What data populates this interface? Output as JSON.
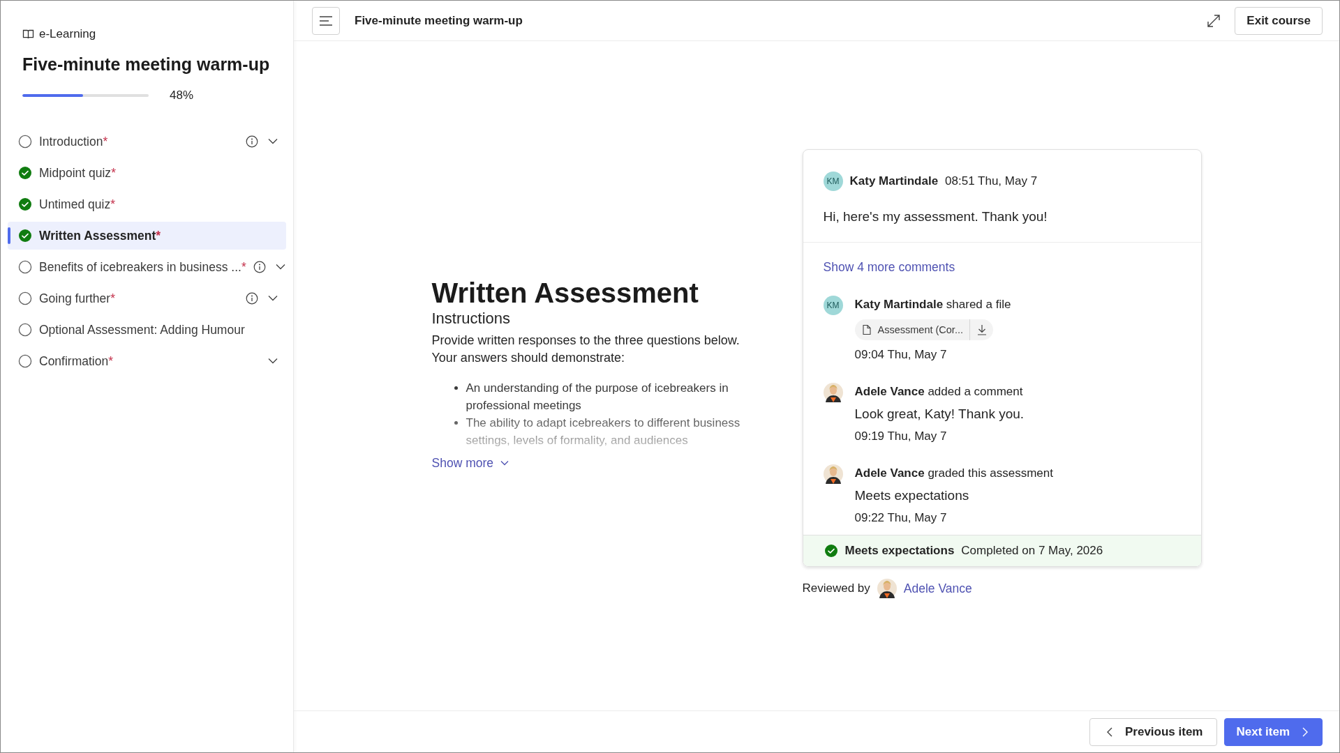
{
  "sidebar": {
    "app_name": "e-Learning",
    "course_title": "Five-minute meeting warm-up",
    "progress": {
      "level": 0.48,
      "reading": "48%"
    },
    "items": [
      {
        "label": "Introduction",
        "mark": "*",
        "done": false,
        "info": true,
        "expandable": true,
        "selected": false
      },
      {
        "label": "Midpoint quiz",
        "mark": "*",
        "done": true,
        "info": false,
        "expandable": false,
        "selected": false
      },
      {
        "label": "Untimed quiz",
        "mark": "*",
        "done": true,
        "info": false,
        "expandable": false,
        "selected": false
      },
      {
        "label": "Written Assessment",
        "mark": "*",
        "done": true,
        "info": false,
        "expandable": false,
        "selected": true
      },
      {
        "label": "Benefits of icebreakers in business ...",
        "mark": "*",
        "done": false,
        "info": true,
        "expandable": true,
        "selected": false
      },
      {
        "label": "Going further",
        "mark": "*",
        "done": false,
        "info": true,
        "expandable": true,
        "selected": false
      },
      {
        "label": "Optional Assessment: Adding Humour",
        "done": false,
        "info": false,
        "expandable": false,
        "selected": false
      },
      {
        "label": "Confirmation",
        "mark": "*",
        "done": false,
        "info": false,
        "expandable": true,
        "selected": false
      }
    ]
  },
  "topbar": {
    "title": "Five-minute meeting warm-up",
    "exit_label": "Exit course"
  },
  "assessment": {
    "title": "Written Assessment",
    "subtitle": "Instructions",
    "intro": "Provide written responses to the three questions below. Your answers should demonstrate:",
    "bullets": [
      "An understanding of the purpose of icebreakers in professional meetings",
      "The ability to adapt icebreakers to different business settings, levels of formality, and audiences"
    ],
    "show_more": {
      "label": "Show more",
      "expanded": false
    }
  },
  "feed": {
    "post": {
      "avatar": {
        "kind": "initials",
        "initials": "KM"
      },
      "author": "Katy Martindale",
      "time": "08:51 Thu, May 7",
      "message": "Hi, here's my assessment. Thank you!"
    },
    "more_comments": "Show 4 more comments",
    "activities": [
      {
        "avatar": {
          "kind": "initials",
          "initials": "KM"
        },
        "action": "**Katy Martindale** shared a file",
        "file": "Assessment (Cor...",
        "time": "09:04 Thu, May 7"
      },
      {
        "avatar": {
          "kind": "photo"
        },
        "action": "**Adele Vance** added a comment",
        "message": "Look great, Katy! Thank you.",
        "time": "09:19 Thu, May 7"
      },
      {
        "avatar": {
          "kind": "photo"
        },
        "action": "**Adele Vance** graded this assessment",
        "message": "Meets expectations",
        "time": "09:22 Thu, May 7"
      }
    ],
    "result": {
      "grade": "Meets expectations",
      "completed": "Completed on 7 May, 2026"
    },
    "reviewed_by": {
      "label": "Reviewed by",
      "reviewer": "Adele Vance"
    }
  },
  "footer": {
    "previous": "Previous item",
    "next": "Next item"
  }
}
